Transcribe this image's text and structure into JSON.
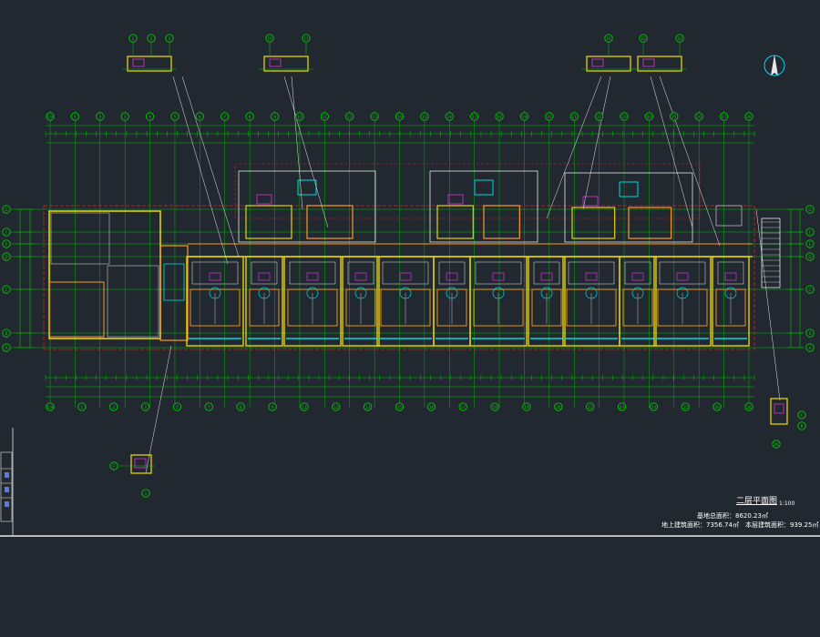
{
  "drawing": {
    "title": "二层平面图",
    "scale": "1:100",
    "area_lines": [
      "基地总面积：8620.23㎡",
      "地上建筑面积：7356.74㎡　本层建筑面积：939.25㎡"
    ],
    "compass_letter": "N"
  },
  "colors": {
    "background": "#212830",
    "axis_green": "#00c800",
    "wall_yellow": "#e6d200",
    "wall_orange": "#ff9a20",
    "detail_white": "#e8e8e8",
    "cyan": "#00d8e8",
    "magenta": "#e030e0",
    "red_dashed": "#e02020",
    "bubble_fill": "#212830"
  },
  "grid": {
    "horizontal_axes": [
      "G",
      "F",
      "E",
      "D",
      "C",
      "B",
      "A"
    ],
    "vertical_axes_top": [
      "1/A",
      "1",
      "2",
      "3",
      "4",
      "5",
      "6",
      "7",
      "8",
      "9",
      "10",
      "11",
      "12",
      "13",
      "14",
      "15",
      "16",
      "17",
      "18",
      "19",
      "20",
      "21",
      "22",
      "23",
      "24",
      "25",
      "26",
      "27",
      "28"
    ],
    "vertical_axes_bottom": [
      "1/A",
      "1",
      "2",
      "3",
      "5",
      "7",
      "8",
      "9",
      "11",
      "12",
      "13",
      "15",
      "16",
      "17",
      "18",
      "19",
      "20",
      "22",
      "23",
      "24",
      "25",
      "26",
      "28"
    ]
  },
  "detail_callouts": [
    {
      "labels": [
        "1",
        "2",
        "3"
      ],
      "position": "top-left"
    },
    {
      "labels": [
        "10",
        "11"
      ],
      "position": "top-center-left"
    },
    {
      "labels": [
        "24"
      ],
      "position": "top-center-right"
    },
    {
      "labels": [
        "22",
        "23"
      ],
      "position": "top-right"
    },
    {
      "labels": [
        "F",
        "1"
      ],
      "position": "bottom-left"
    },
    {
      "labels": [
        "C",
        "B",
        "28"
      ],
      "position": "bottom-right"
    }
  ]
}
